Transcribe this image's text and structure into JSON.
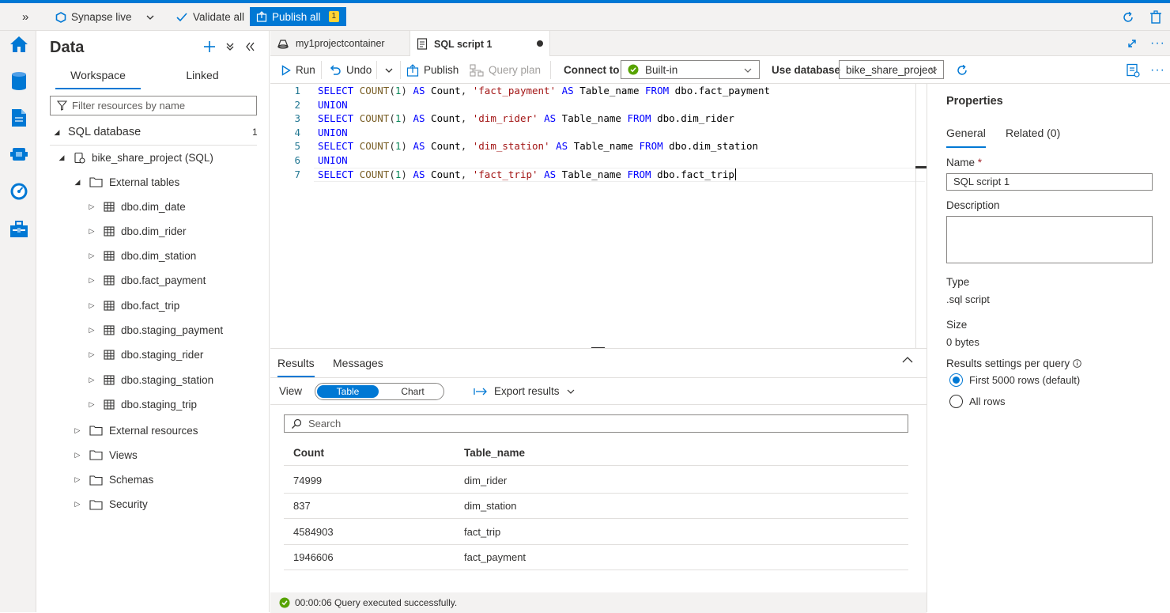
{
  "topbar": {
    "expand_glyph": "»",
    "synapse_live": "Synapse live",
    "validate_all": "Validate all",
    "publish_all": "Publish all",
    "publish_count": "1"
  },
  "panel": {
    "title": "Data",
    "tabs": [
      "Workspace",
      "Linked"
    ],
    "filter_placeholder": "Filter resources by name",
    "section": "SQL database",
    "section_count": "1",
    "database": "bike_share_project (SQL)",
    "external_tables_label": "External tables",
    "tables": [
      "dbo.dim_date",
      "dbo.dim_rider",
      "dbo.dim_station",
      "dbo.fact_payment",
      "dbo.fact_trip",
      "dbo.staging_payment",
      "dbo.staging_rider",
      "dbo.staging_station",
      "dbo.staging_trip"
    ],
    "folders": [
      "External resources",
      "Views",
      "Schemas",
      "Security"
    ]
  },
  "doc_tabs": [
    "my1projectcontainer",
    "SQL script 1"
  ],
  "toolbar": {
    "run": "Run",
    "undo": "Undo",
    "publish": "Publish",
    "query_plan": "Query plan",
    "connect_to": "Connect to",
    "connection": "Built-in",
    "use_database": "Use database",
    "database": "bike_share_project"
  },
  "editor": {
    "lines": [
      {
        "n": "1",
        "t": "fact_payment",
        "tbl": "dbo.fact_payment"
      },
      {
        "n": "2",
        "union": "UNION"
      },
      {
        "n": "3",
        "t": "dim_rider",
        "tbl": "dbo.dim_rider"
      },
      {
        "n": "4",
        "union": "UNION"
      },
      {
        "n": "5",
        "t": "dim_station",
        "tbl": "dbo.dim_station"
      },
      {
        "n": "6",
        "union": "UNION"
      },
      {
        "n": "7",
        "t": "fact_trip",
        "tbl": "dbo.fact_trip"
      }
    ]
  },
  "results": {
    "tabs": [
      "Results",
      "Messages"
    ],
    "view_label": "View",
    "view_options": [
      "Table",
      "Chart"
    ],
    "export": "Export results",
    "search_placeholder": "Search",
    "columns": [
      "Count",
      "Table_name"
    ],
    "rows": [
      [
        "74999",
        "dim_rider"
      ],
      [
        "837",
        "dim_station"
      ],
      [
        "4584903",
        "fact_trip"
      ],
      [
        "1946606",
        "fact_payment"
      ]
    ],
    "status": "00:00:06 Query executed successfully."
  },
  "properties": {
    "title": "Properties",
    "tabs": [
      "General",
      "Related (0)"
    ],
    "name_label": "Name",
    "required_mark": "*",
    "name_value": "SQL script 1",
    "description_label": "Description",
    "type_label": "Type",
    "type_value": ".sql script",
    "size_label": "Size",
    "size_value": "0 bytes",
    "results_settings_label": "Results settings per query",
    "options": [
      "First 5000 rows (default)",
      "All rows"
    ]
  }
}
